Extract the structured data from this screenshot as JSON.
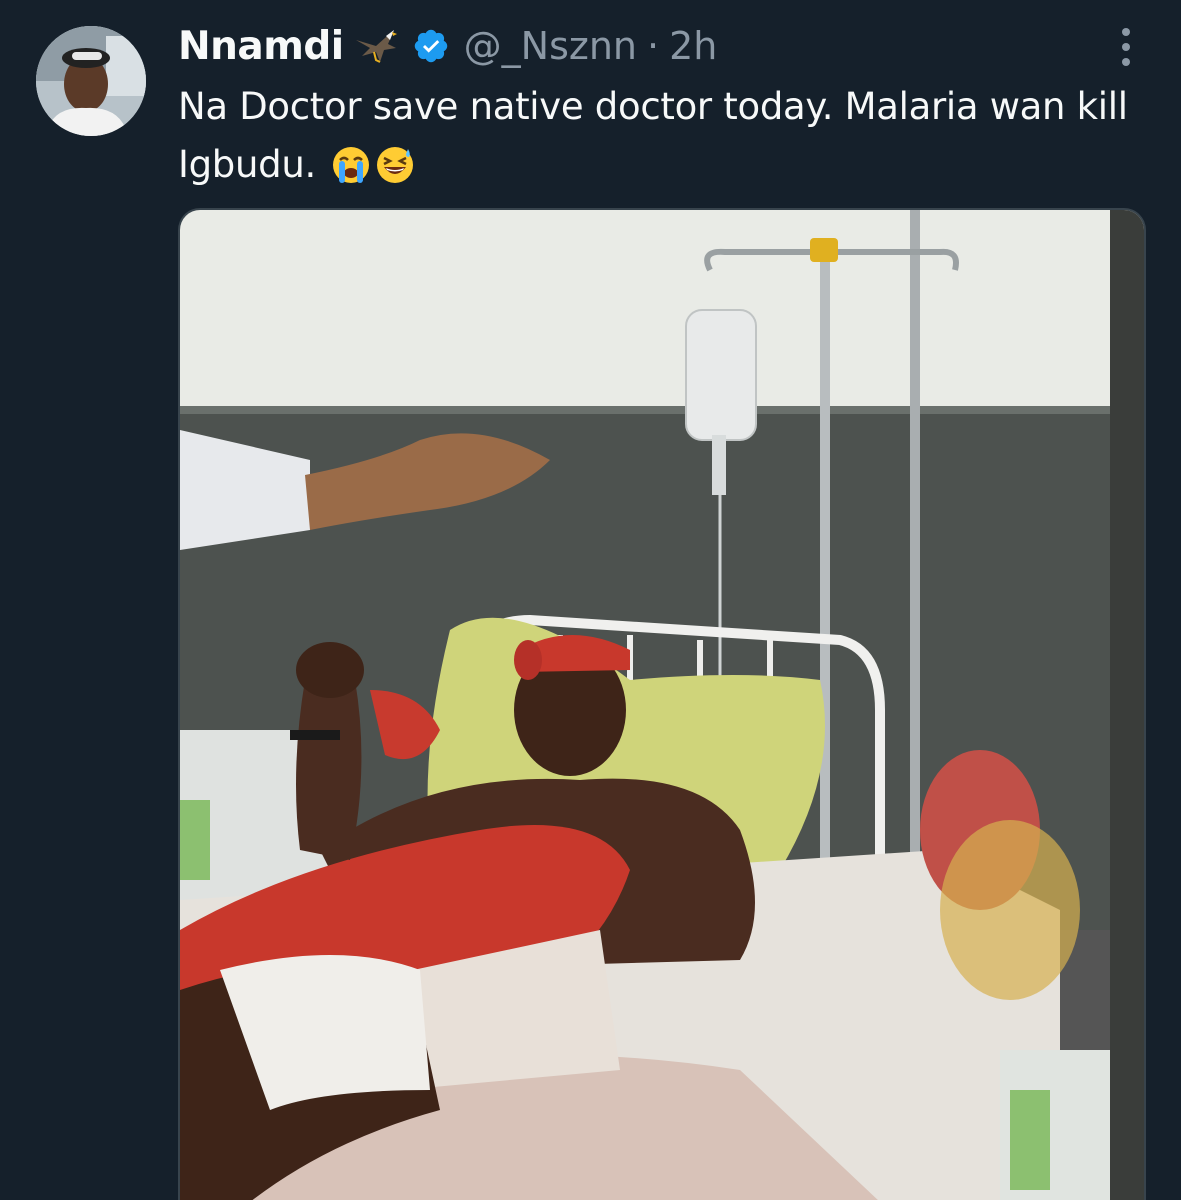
{
  "tweet": {
    "display_name": "Nnamdi",
    "handle": "@_Nsznn",
    "separator": "·",
    "time": "2h",
    "text": "Na Doctor save native doctor today. Malaria wan kill Igbudu.",
    "emojis": [
      "loudly-crying-face",
      "grinning-squinting-face-with-sweat"
    ]
  },
  "icons": {
    "name_emoji": "eagle-icon",
    "verified": "verified-badge-icon",
    "more": "more-options-icon"
  },
  "colors": {
    "background": "#15202b",
    "primary_text": "#f7f9f9",
    "secondary_text": "#8b98a5",
    "verified_blue": "#1d9bf0",
    "border": "#38444d"
  }
}
